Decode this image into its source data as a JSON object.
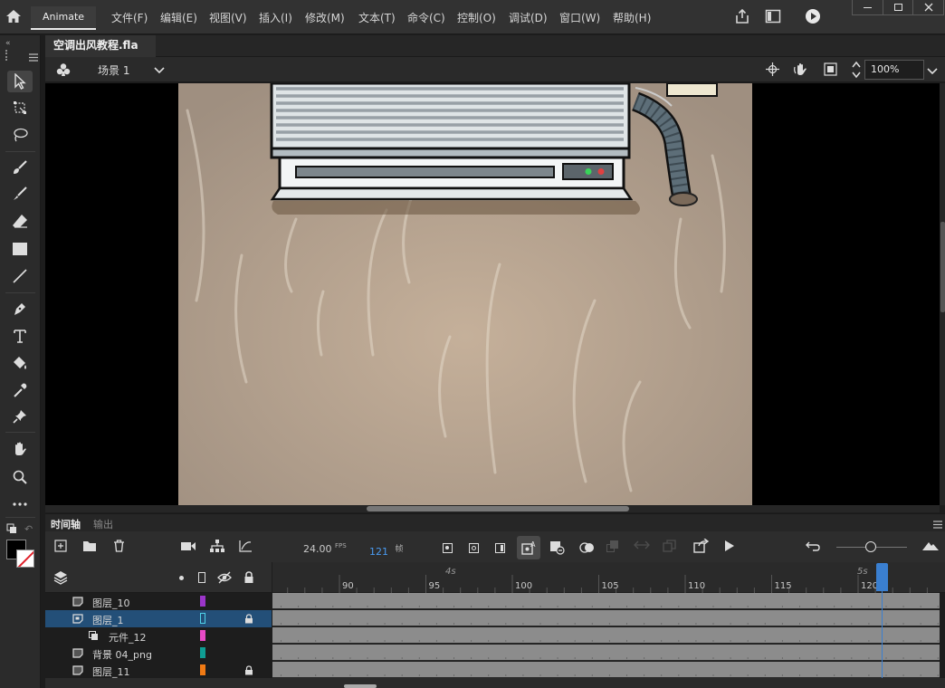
{
  "app": {
    "name": "Animate"
  },
  "menu": [
    "文件(F)",
    "编辑(E)",
    "视图(V)",
    "插入(I)",
    "修改(M)",
    "文本(T)",
    "命令(C)",
    "控制(O)",
    "调试(D)",
    "窗口(W)",
    "帮助(H)"
  ],
  "document": {
    "tab_title": "空调出风教程.fla",
    "close": "×"
  },
  "edit_bar": {
    "scene": "场景 1",
    "zoom": "100%"
  },
  "panel_tabs": {
    "timeline": "时间轴",
    "output": "输出"
  },
  "timeline": {
    "fps": "24.00",
    "fps_unit": "FPS",
    "frame": "121",
    "frame_unit": "帧",
    "ruler_ticks": [
      "90",
      "95",
      "100",
      "105",
      "110",
      "115",
      "120"
    ],
    "ruler_seconds": [
      "4s",
      "5s"
    ],
    "layers": [
      {
        "name": "图层_10",
        "color": "#9b35c9",
        "locked": false,
        "selected": false,
        "indent": 0
      },
      {
        "name": "图层_1",
        "color": "#4fd3ea",
        "locked": true,
        "selected": true,
        "indent": 0
      },
      {
        "name": "元件_12",
        "color": "#e84ac6",
        "locked": false,
        "selected": false,
        "indent": 1
      },
      {
        "name": "背景 04_png",
        "color": "#0f9d93",
        "locked": false,
        "selected": false,
        "indent": 0
      },
      {
        "name": "图层_11",
        "color": "#f07a14",
        "locked": true,
        "selected": false,
        "indent": 0
      }
    ]
  },
  "colors": {
    "accent": "#3c8ae0",
    "selection": "#234f78",
    "playhead": "#3a7fd0"
  }
}
